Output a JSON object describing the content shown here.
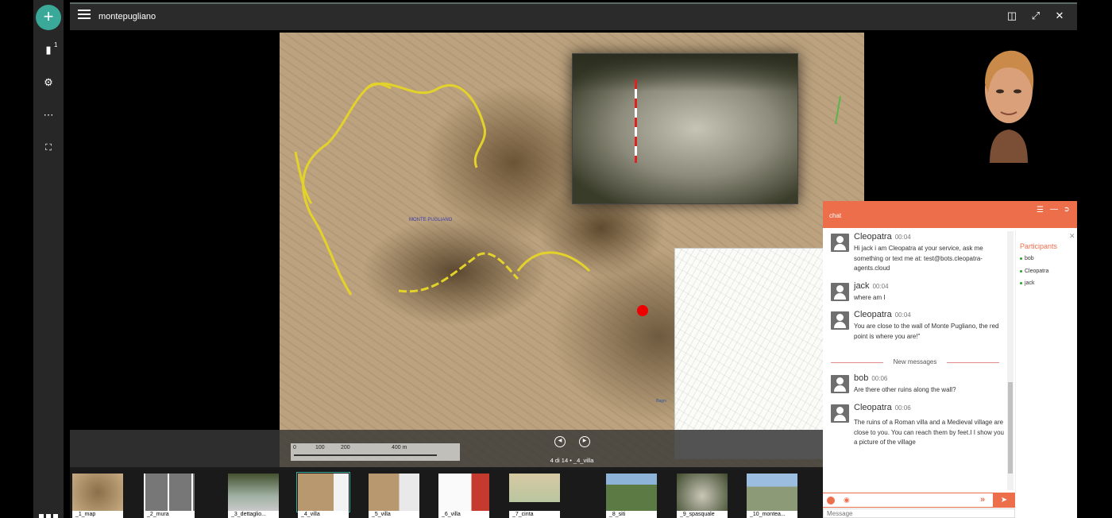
{
  "app": {
    "title": "montepugliano"
  },
  "rail": {
    "add_label": "+",
    "badge": "1"
  },
  "viewer": {
    "pager": "4 di 14 • _4_villa",
    "map_labels": {
      "place": "MONTE PUGLIANO",
      "other": "Bagni"
    },
    "scale": {
      "ticks": [
        "0",
        "100",
        "200",
        "400 m"
      ]
    }
  },
  "thumbnails": [
    {
      "label": "_1_map"
    },
    {
      "label": "_2_mura"
    },
    {
      "label": "_3_dettaglio..."
    },
    {
      "label": "_4_villa"
    },
    {
      "label": "_5_villa"
    },
    {
      "label": "_6_villa"
    },
    {
      "label": "_7_cinta"
    },
    {
      "label": "_8_siti"
    },
    {
      "label": "_9_spasquale"
    },
    {
      "label": "_10_montea..."
    }
  ],
  "chat": {
    "title": "chat",
    "messages": [
      {
        "author": "Cleopatra",
        "time": "00:04",
        "text": "Hi jack i am Cleopatra at your service, ask me something or text me at: test@bots.cleopatra-agents.cloud"
      },
      {
        "author": "jack",
        "time": "00:04",
        "text": "where am I"
      },
      {
        "author": "Cleopatra",
        "time": "00:04",
        "text": "You are close to the wall of Monte Pugliano, the red point is where you are!\""
      },
      {
        "author": "bob",
        "time": "00:06",
        "text": "Are there other ruins along the wall?"
      },
      {
        "author": "Cleopatra",
        "time": "00:06",
        "text": "The ruins of a Roman villa and a Medieval village are close to you. You can reach them by feet.I I show you a picture of the village"
      }
    ],
    "new_messages_label": "New messages",
    "participants_title": "Participants",
    "participants": [
      "bob",
      "Cleopatra",
      "jack"
    ],
    "input_placeholder": "Message"
  },
  "colors": {
    "accent": "#ec6e4b",
    "teal": "#3aa99a",
    "map_route": "#e3d22a",
    "red_point": "#e00000"
  },
  "icons": [
    "add-icon",
    "slides-icon",
    "gear-icon",
    "more-icon",
    "fullscreen-icon",
    "menu-icon",
    "split-view-icon",
    "expand-icon",
    "close-icon",
    "prev-icon",
    "next-icon",
    "emoji-icon",
    "eye-icon",
    "send-icon",
    "grid-icon"
  ]
}
